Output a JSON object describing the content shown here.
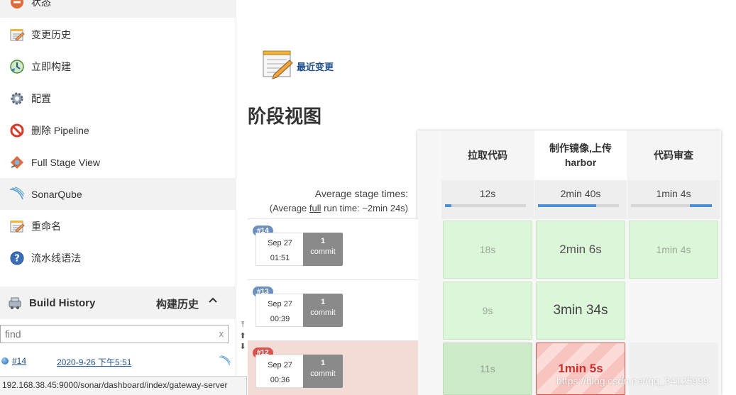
{
  "sidebar": {
    "items": [
      {
        "label": "状态",
        "icon": "status-icon"
      },
      {
        "label": "变更历史",
        "icon": "notepad-icon"
      },
      {
        "label": "立即构建",
        "icon": "build-clock-icon"
      },
      {
        "label": "配置",
        "icon": "gear-icon"
      },
      {
        "label": "删除 Pipeline",
        "icon": "no-entry-icon"
      },
      {
        "label": "Full Stage View",
        "icon": "stage-view-icon"
      },
      {
        "label": "SonarQube",
        "icon": "sonarqube-icon"
      },
      {
        "label": "重命名",
        "icon": "notepad-icon"
      },
      {
        "label": "流水线语法",
        "icon": "help-icon"
      }
    ]
  },
  "build_history": {
    "title": "Build History",
    "title_cn": "构建历史",
    "caret": "^",
    "find_placeholder": "find",
    "clear": "x",
    "latest": {
      "number": "#14",
      "date": "2020-9-26 下午5:51"
    }
  },
  "status_bar": {
    "url": "192.168.38.45:9000/sonar/dashboard/index/gateway-server"
  },
  "main": {
    "recent_changes": "最近变更",
    "title": "阶段视图",
    "avg_stage_times": "Average stage times:",
    "avg_full_prefix": "(Average ",
    "avg_full_link": "full",
    "avg_full_suffix": " run time: ~2min 24s)"
  },
  "stages": [
    {
      "name": "拉取代码",
      "avg": "12s",
      "avg_fraction": 0.08
    },
    {
      "name_line1": "制作镜像,上传",
      "name_line2": "harbor",
      "avg": "2min 40s",
      "avg_fraction": 0.72
    },
    {
      "name": "代码审查",
      "avg": "1min 4s",
      "avg_fraction": 0.27
    }
  ],
  "builds": [
    {
      "badge": "#14",
      "date": "Sep 27",
      "time": "01:51",
      "commits": "1",
      "commit_label": "commit",
      "durations": [
        "18s",
        "2min 6s",
        "1min 4s"
      ]
    },
    {
      "badge": "#13",
      "date": "Sep 27",
      "time": "00:39",
      "commits": "1",
      "commit_label": "commit",
      "durations": [
        "9s",
        "3min 34s",
        ""
      ]
    },
    {
      "badge": "#12",
      "date": "Sep 27",
      "time": "00:36",
      "commits": "1",
      "commit_label": "commit",
      "durations": [
        "11s",
        "1min 5s",
        ""
      ]
    }
  ],
  "watermark": "https://blog.csdn.net/qq_34125999",
  "colors": {
    "link": "#1e4e8c",
    "progress": "#4a90d9",
    "success": "#dcf6d9",
    "fail": "#d9534f"
  }
}
